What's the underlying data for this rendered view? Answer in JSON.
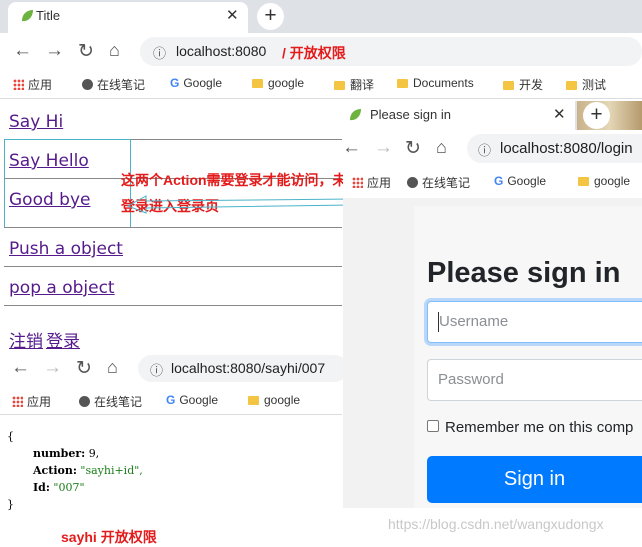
{
  "main_browser": {
    "tab_title": "Title",
    "url": "localhost:8080",
    "url_annotation": "/ 开放权限",
    "bookmarks": [
      "应用",
      "在线笔记",
      "Google",
      "google",
      "翻译",
      "Documents",
      "开发",
      "测试"
    ]
  },
  "page_links": {
    "say_hi": "Say Hi",
    "say_hello": "Say Hello",
    "good_bye": "Good bye",
    "push": "Push a object",
    "pop": "pop a object",
    "logout": "注销",
    "login": "登录"
  },
  "annotation": {
    "line1": "这两个Action需要登录才能访问，未",
    "line2": "登录进入登录页"
  },
  "sayhi_browser": {
    "url": "localhost:8080/sayhi/007",
    "bookmarks": [
      "应用",
      "在线笔记",
      "Google",
      "google"
    ]
  },
  "json_response": {
    "open": "{",
    "number_key": "number:",
    "number_val": "9,",
    "action_key": "Action:",
    "action_val": "\"sayhi+id\",",
    "id_key": "Id:",
    "id_val": "\"007\"",
    "close": "}"
  },
  "sayhi_caption": "sayhi 开放权限",
  "login_browser": {
    "tab_title": "Please sign in",
    "url": "localhost:8080/login",
    "bookmarks": [
      "应用",
      "在线笔记",
      "Google",
      "google"
    ]
  },
  "login_form": {
    "title": "Please sign in",
    "username_placeholder": "Username",
    "password_placeholder": "Password",
    "remember": "Remember me on this comp",
    "button": "Sign in"
  },
  "watermark": "https://blog.csdn.net/wangxudongx",
  "colors": {
    "accent_red": "#e41b1b",
    "primary_blue": "#007bff",
    "link_purple": "#551a8b"
  }
}
